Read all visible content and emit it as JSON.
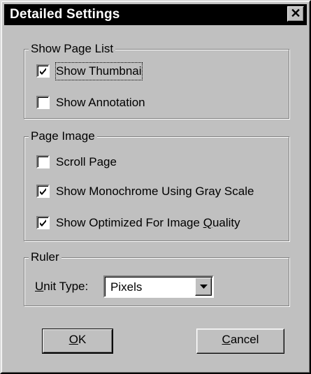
{
  "dialog": {
    "title": "Detailed Settings",
    "close_symbol": "✕"
  },
  "show_page_list": {
    "legend": "Show Page List",
    "items": [
      {
        "label": "Show Thumbnai",
        "checked": true
      },
      {
        "label": "Show Annotation",
        "checked": false
      }
    ]
  },
  "page_image": {
    "legend": "Page Image",
    "items": [
      {
        "label": "Scroll Page",
        "checked": false
      },
      {
        "label_pre": "Show Monochrome Using Gray Scale",
        "checked": true
      },
      {
        "label_pre": "Show Optimized For Image ",
        "label_u": "Q",
        "label_post": "uality",
        "checked": true
      }
    ]
  },
  "ruler": {
    "legend": "Ruler",
    "unit_label_u": "U",
    "unit_label_post": "nit Type:",
    "unit_value": "Pixels"
  },
  "buttons": {
    "ok_u": "O",
    "ok_post": "K",
    "cancel_u": "C",
    "cancel_post": "ancel"
  },
  "icons": {
    "check": "checkmark-icon",
    "dropdown": "dropdown-arrow-icon",
    "close": "close-icon"
  },
  "colors": {
    "face": "#c0c0c0",
    "titlebar": "#000000",
    "title_text": "#ffffff"
  }
}
